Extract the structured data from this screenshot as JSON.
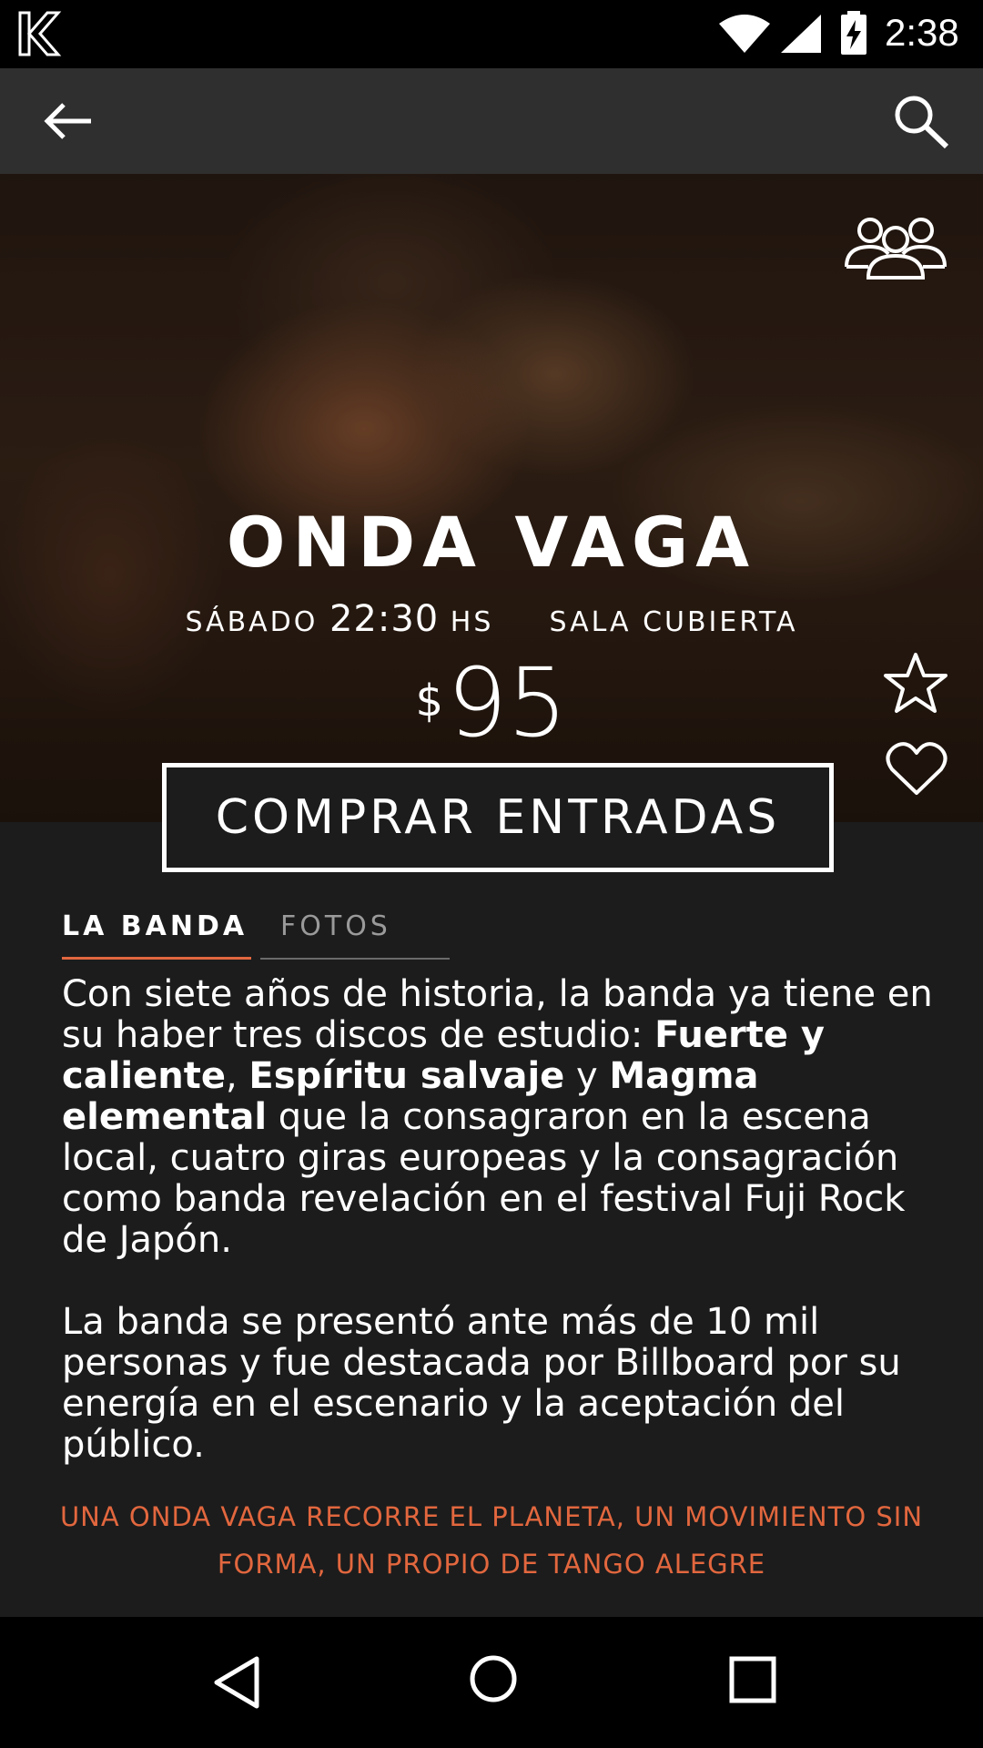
{
  "status_bar": {
    "time": "2:38",
    "icons": [
      "app-logo-icon",
      "wifi-icon",
      "signal-icon",
      "battery-charging-icon"
    ]
  },
  "toolbar": {
    "back_icon": "arrow-left-icon",
    "search_icon": "search-icon"
  },
  "event": {
    "title": "ONDA VAGA",
    "day": "SÁBADO",
    "time": "22:30",
    "time_suffix": "HS",
    "venue": "SALA CUBIERTA",
    "currency": "$",
    "price": "95",
    "buy_label": "COMPRAR ENTRADAS",
    "group_icon": "group-icon",
    "star_icon": "star-outline-icon",
    "heart_icon": "heart-outline-icon"
  },
  "tabs": [
    {
      "label": "LA BANDA",
      "active": true
    },
    {
      "label": "FOTOS",
      "active": false
    }
  ],
  "description": {
    "p1_a": "Con siete años de historia, la banda ya tiene en su haber tres discos de estudio: ",
    "album1": "Fuerte y caliente",
    "sep1": ", ",
    "album2": "Espíritu salvaje",
    "sep2": " y ",
    "album3": "Magma elemental",
    "p1_b": " que la consagraron en la escena local, cuatro giras europeas y la consagración como banda revelación en el festival Fuji Rock de Japón.",
    "p2": "La banda se presentó ante más de 10 mil personas y fue destacada por Billboard por su energía en el escenario y la aceptación del público."
  },
  "tagline": "UNA ONDA VAGA RECORRE EL PLANETA, UN MOVIMIENTO SIN FORMA, UN PROPIO DE TANGO ALEGRE",
  "colors": {
    "accent": "#e2673e",
    "background": "#1c1c1c",
    "toolbar": "#2f2f2f"
  },
  "nav_bar": {
    "icons": [
      "nav-back-icon",
      "nav-home-icon",
      "nav-recent-icon"
    ]
  }
}
